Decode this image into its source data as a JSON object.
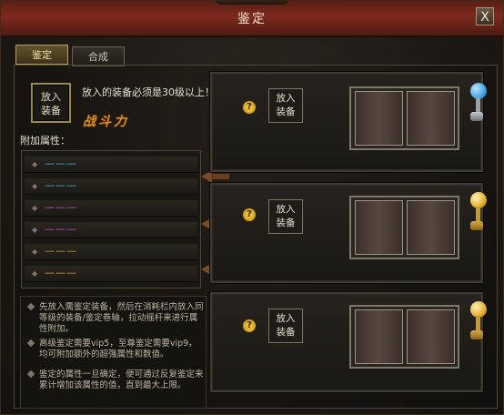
{
  "window": {
    "title": "鉴定",
    "close_label": "X"
  },
  "tabs": [
    {
      "label": "鉴定",
      "active": true
    },
    {
      "label": "合成",
      "active": false
    }
  ],
  "left": {
    "slot_line1": "放入",
    "slot_line2": "装备",
    "notice": "放入的装备必须是30级以上！",
    "power_label": "战斗力",
    "attr_label": "附加属性：",
    "attributes": [
      {
        "value": "———",
        "color": "#3fb7d8"
      },
      {
        "value": "———",
        "color": "#3fb7d8"
      },
      {
        "value": "———",
        "color": "#c94fc9"
      },
      {
        "value": "———",
        "color": "#c94fc9"
      },
      {
        "value": "———",
        "color": "#d79a3a"
      },
      {
        "value": "———",
        "color": "#d79a3a"
      }
    ],
    "tips": [
      "先放入需鉴定装备，然后在消耗栏内放入同等级的装备/鉴定卷轴，拉动摇杆来进行属性附加。",
      "高级鉴定需要vip5，至尊鉴定需要vip9，均可附加额外的超强属性和数值。",
      "鉴定的属性一旦确定，便可通过反复鉴定来累计增加该属性的值，直到最大上限。"
    ]
  },
  "cards": [
    {
      "help_icon": "question-icon",
      "help_glyph": "?",
      "slot_line1": "放入",
      "slot_line2": "装备",
      "lever_color": "#4aa7e6"
    },
    {
      "help_icon": "question-icon",
      "help_glyph": "?",
      "slot_line1": "放入",
      "slot_line2": "装备",
      "lever_color": "#e8b53a"
    },
    {
      "help_icon": "question-icon",
      "help_glyph": "?",
      "slot_line1": "放入",
      "slot_line2": "装备",
      "lever_color": "#e8b53a"
    }
  ]
}
